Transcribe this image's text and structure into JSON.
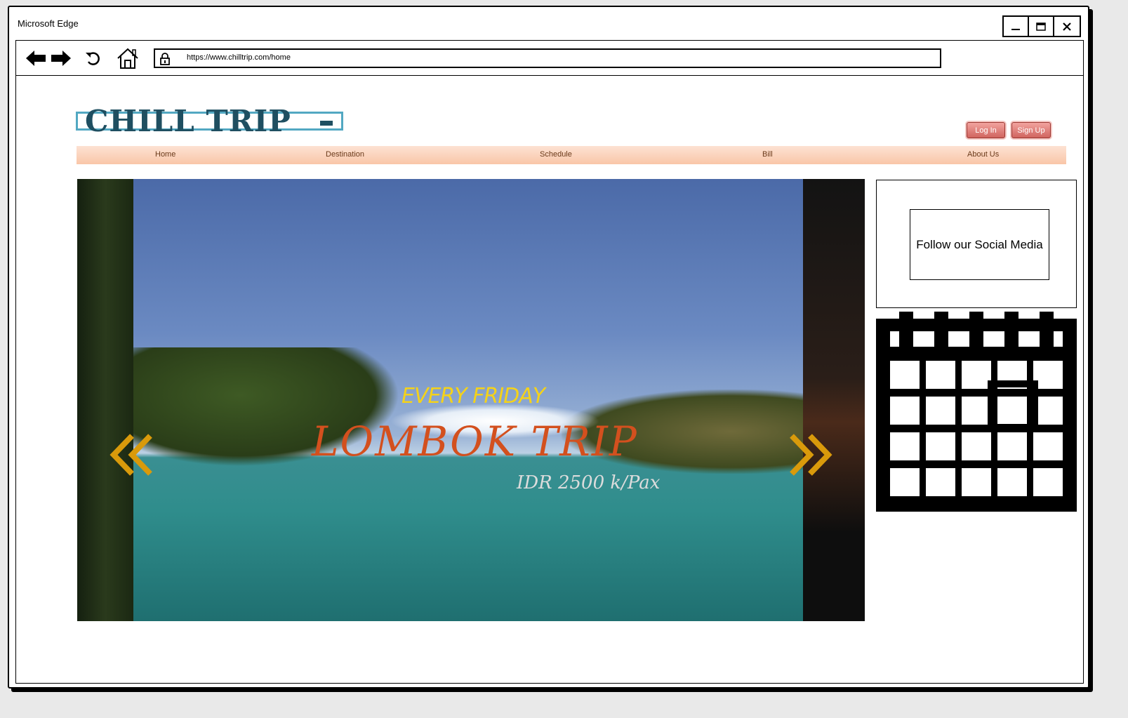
{
  "window": {
    "title": "Microsoft Edge",
    "controls": [
      "minimize",
      "maximize",
      "close"
    ]
  },
  "browser": {
    "url": "https://www.chilltrip.com/home",
    "nav_icons": [
      "back-arrow-icon",
      "forward-arrow-icon",
      "refresh-icon",
      "home-icon",
      "lock-icon"
    ]
  },
  "site": {
    "logo": "CHILL TRIP",
    "auth": {
      "login": "Log In",
      "signup": "Sign Up"
    },
    "menu": [
      {
        "label": "Home"
      },
      {
        "label": "Destination"
      },
      {
        "label": "Schedule"
      },
      {
        "label": "Bill"
      },
      {
        "label": "About Us"
      }
    ]
  },
  "hero": {
    "line1": "EVERY FRIDAY",
    "line2": "LOMBOK TRIP",
    "line3": "IDR 2500 k/Pax",
    "prev_icon": "chevron-double-left-icon",
    "next_icon": "chevron-double-right-icon"
  },
  "sidebar": {
    "social": "Follow our Social Media",
    "calendar_icon": "calendar-icon"
  },
  "colors": {
    "logo": "#1f4f61",
    "logo_border": "#52a8c2",
    "menu_text": "#6a3a1a",
    "button": "#d0655f",
    "hero_title": "#d3501e",
    "hero_subtitle": "#f4d21a",
    "arrows": "#d99a0b"
  }
}
